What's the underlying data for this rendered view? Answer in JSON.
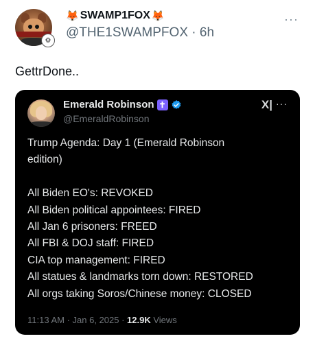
{
  "post": {
    "display_name": "SWAMP1FOX",
    "handle": "@THE1SWAMPFOX",
    "separator": "·",
    "time_ago": "6h",
    "text": "GettrDone.."
  },
  "quoted": {
    "display_name": "Emerald Robinson",
    "handle": "@EmeraldRobinson",
    "title_line1": "Trump Agenda: Day 1 (Emerald Robinson",
    "title_line2": "edition)",
    "lines": [
      "All Biden EO's: REVOKED",
      "All Biden political appointees: FIRED",
      "All Jan 6 prisoners: FREED",
      "All FBI & DOJ staff: FIRED",
      "CIA top management: FIRED",
      "All statues & landmarks torn down: RESTORED",
      "All orgs taking Soros/Chinese money: CLOSED"
    ],
    "timestamp": "11:13 AM · Jan 6, 2025 ·",
    "views_count": "12.9K",
    "views_label": "Views"
  },
  "icons": {
    "fox": "fox-emoji-icon",
    "more": "more-icon",
    "cross": "cross-icon",
    "verified": "verified-icon",
    "x_logo": "x-logo-icon"
  },
  "colors": {
    "card_bg": "#000000",
    "verified": "#1d9bf0",
    "cross_badge": "#7b61ff"
  }
}
